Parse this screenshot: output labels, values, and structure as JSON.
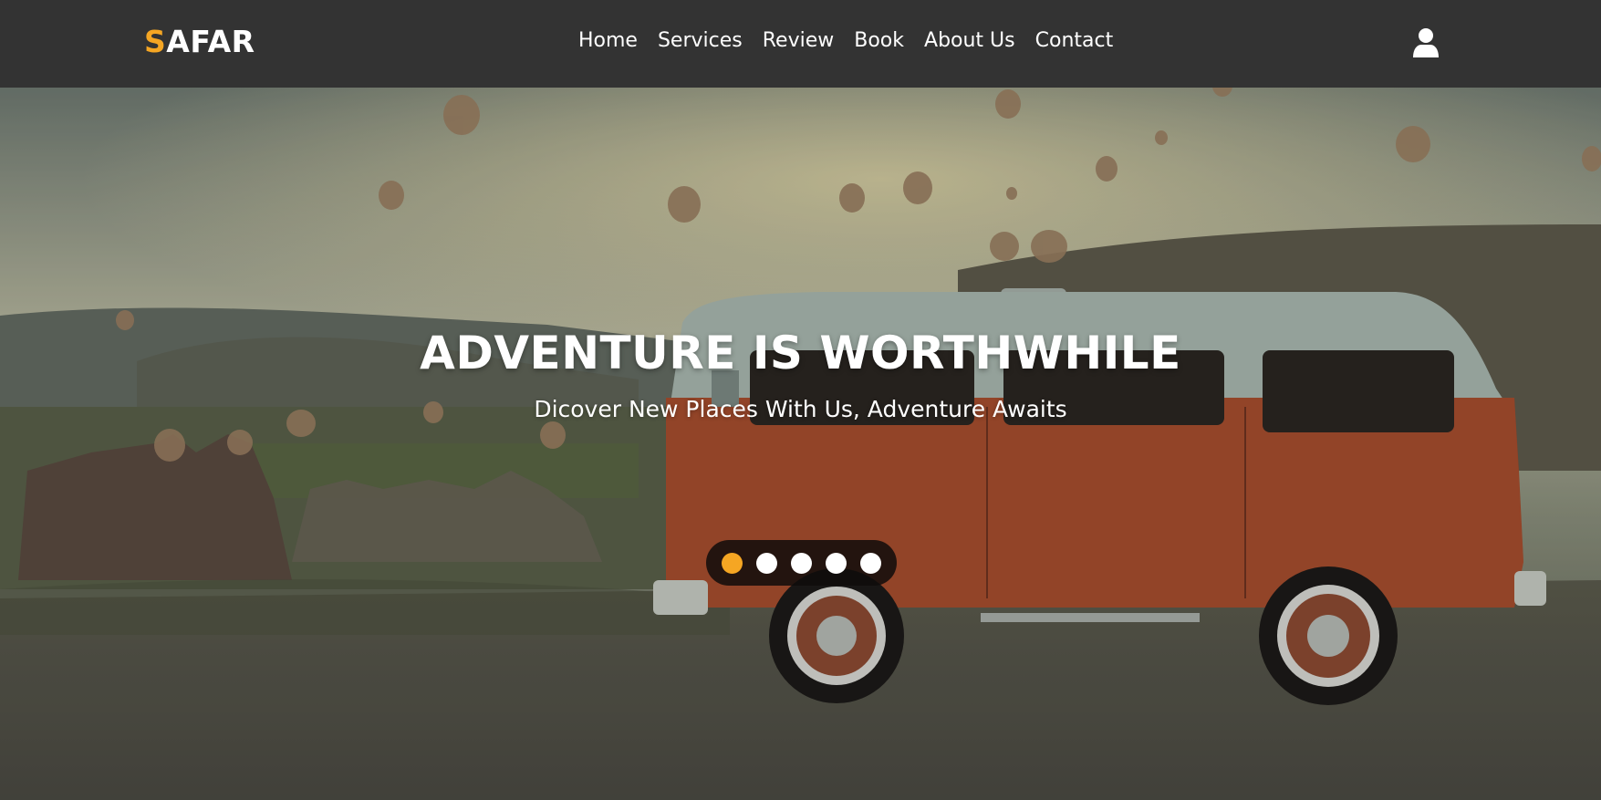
{
  "brand": {
    "first_letter": "S",
    "rest": "AFAR",
    "accent_color": "#f5a623"
  },
  "nav": {
    "items": [
      {
        "label": "Home"
      },
      {
        "label": "Services"
      },
      {
        "label": "Review"
      },
      {
        "label": "Book"
      },
      {
        "label": "About Us"
      },
      {
        "label": "Contact"
      }
    ],
    "user_icon": "user-icon"
  },
  "hero": {
    "title": "ADVENTURE IS WORTHWHILE",
    "subtitle": "Dicover New Places With Us, Adventure Awaits",
    "background": "hot-air-balloons-and-vintage-van-photo"
  },
  "slider": {
    "slide_count": 5,
    "active_index": 0,
    "active_color": "#f5a623",
    "inactive_color": "#ffffff"
  }
}
